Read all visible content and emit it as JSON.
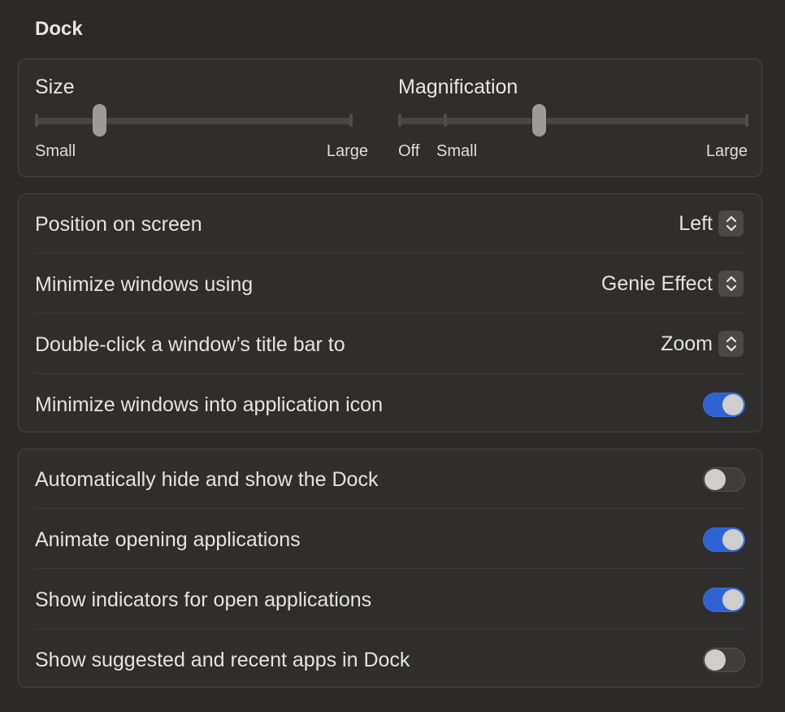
{
  "section": {
    "title": "Dock"
  },
  "sliders": {
    "size": {
      "title": "Size",
      "min_label": "Small",
      "max_label": "Large",
      "value": 0.2,
      "ticks": [
        0,
        1
      ]
    },
    "magnification": {
      "title": "Magnification",
      "off_label": "Off",
      "min_label": "Small",
      "max_label": "Large",
      "value": 0.4,
      "ticks": [
        0,
        0.13,
        1
      ]
    }
  },
  "popups": [
    {
      "label": "Position on screen",
      "value": "Left"
    },
    {
      "label": "Minimize windows using",
      "value": "Genie Effect"
    },
    {
      "label": "Double-click a window’s title bar to",
      "value": "Zoom"
    }
  ],
  "popup_group_toggle": {
    "label": "Minimize windows into application icon",
    "on": true
  },
  "toggles": [
    {
      "label": "Automatically hide and show the Dock",
      "on": false
    },
    {
      "label": "Animate opening applications",
      "on": true
    },
    {
      "label": "Show indicators for open applications",
      "on": true
    },
    {
      "label": "Show suggested and recent apps in Dock",
      "on": false
    }
  ],
  "colors": {
    "accent": "#2f63d3",
    "background": "#2b2a28",
    "group_background": "#2f2e2c"
  }
}
